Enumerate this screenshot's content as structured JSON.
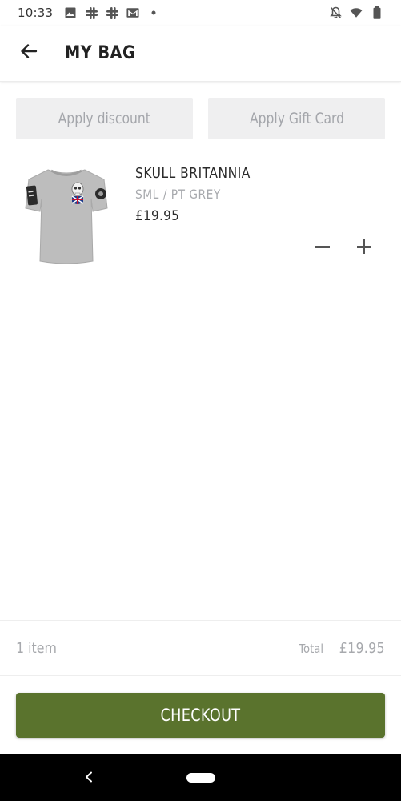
{
  "status_bar": {
    "time": "10:33",
    "left_icons": [
      "image-icon",
      "slack-icon",
      "slack-icon",
      "gmail-icon",
      "dot-icon"
    ],
    "right_icons": [
      "notifications-off-icon",
      "wifi-icon",
      "battery-icon"
    ]
  },
  "header": {
    "back_icon": "arrow-left-icon",
    "title": "MY BAG"
  },
  "actions": {
    "apply_discount": "Apply discount",
    "apply_gift_card": "Apply Gift Card"
  },
  "cart": {
    "items": [
      {
        "name": "SKULL BRITANNIA",
        "variant": "SML / PT GREY",
        "price": "£19.95",
        "image": "grey-tshirt-skull-union-jack"
      }
    ]
  },
  "summary": {
    "item_count": "1 item",
    "total_label": "Total",
    "total_value": "£19.95"
  },
  "checkout": {
    "label": "CHECKOUT",
    "color": "#5a732d"
  },
  "nav_bar": {
    "back_icon": "nav-back-icon",
    "home_icon": "home-pill-icon"
  }
}
